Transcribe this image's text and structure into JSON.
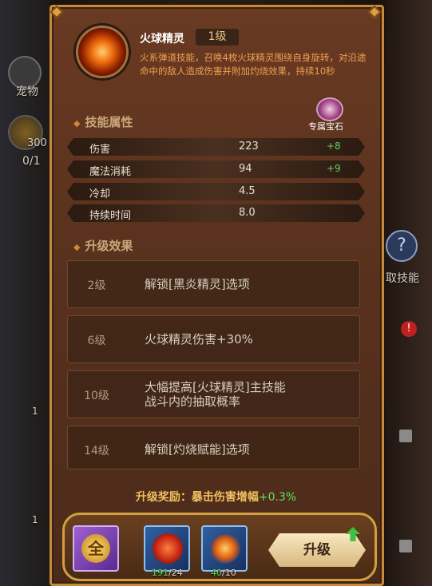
{
  "side": {
    "pet_label": "宠物",
    "coin_count": "300",
    "ratio": "0/1",
    "left_badge1": "1",
    "left_badge2": "1",
    "right_label": "取技能"
  },
  "skill": {
    "name": "火球精灵",
    "level": "1级",
    "description": "火系弹道技能，召唤4枚火球精灵围绕自身旋转，对沿途命中的敌人造成伤害并附加灼烧效果，持续10秒"
  },
  "gem": {
    "label": "专属宝石"
  },
  "attributes": {
    "title": "技能属性",
    "rows": [
      {
        "name": "伤害",
        "value": "223",
        "add": "+8"
      },
      {
        "name": "魔法消耗",
        "value": "94",
        "add": "+9"
      },
      {
        "name": "冷却",
        "value": "4.5",
        "add": ""
      },
      {
        "name": "持续时间",
        "value": "8.0",
        "add": ""
      }
    ]
  },
  "upgrades": {
    "title": "升级效果",
    "rows": [
      {
        "level": "2级",
        "text": "解锁[黑炎精灵]选项"
      },
      {
        "level": "6级",
        "text": "火球精灵伤害+30%"
      },
      {
        "level": "10级",
        "text": "大幅提高[火球精灵]主技能\n战斗内的抽取概率"
      },
      {
        "level": "14级",
        "text": "解锁[灼烧赋能]选项"
      }
    ]
  },
  "reward": {
    "label": "升级奖励：暴击伤害增幅",
    "value": "+0.3%"
  },
  "items": {
    "all_label": "全",
    "a_have": "191",
    "a_need": "/24",
    "b_have": "40",
    "b_need": "/10"
  },
  "upgrade_button": "升级"
}
